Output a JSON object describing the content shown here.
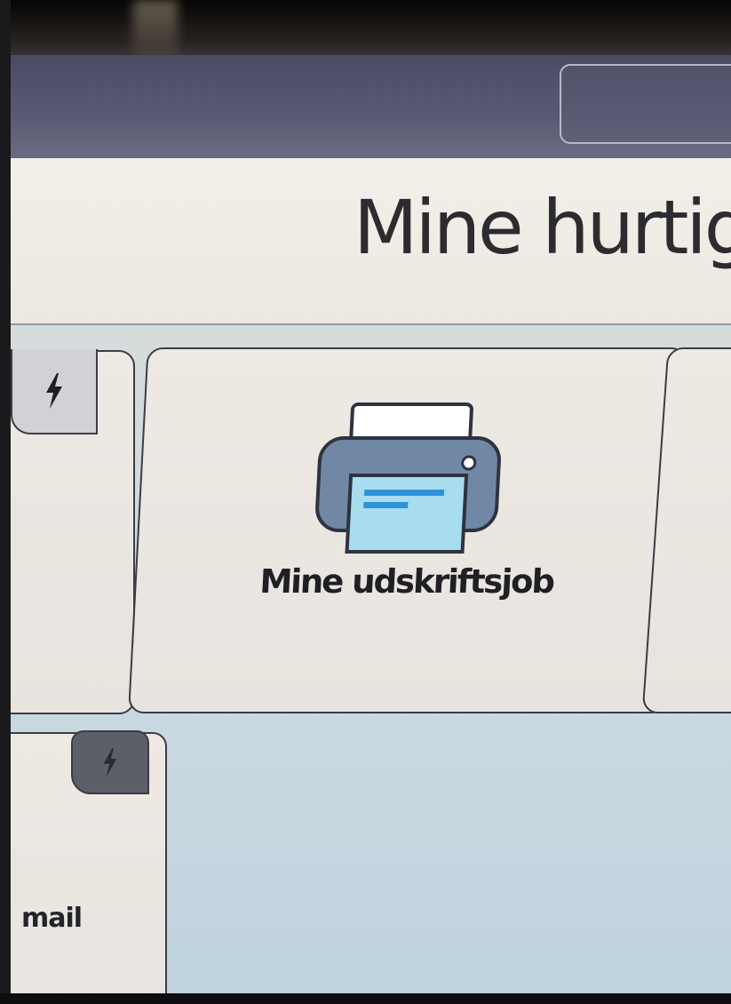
{
  "header": {
    "title": "Mine hurtige l"
  },
  "tiles": {
    "center": {
      "label": "Mine udskriftsjob",
      "icon": "printer-icon"
    },
    "bottom_left": {
      "label": "mail"
    }
  },
  "icons": {
    "quick_set": "lightning-bolt-icon"
  },
  "colors": {
    "top_bar": "#5a5a74",
    "header_background": "#f0ece6",
    "tile_background": "#ebe7e1",
    "printer_body": "#6f86a3",
    "paper": "#a8dcef",
    "text_lines": "#2d93d8"
  }
}
